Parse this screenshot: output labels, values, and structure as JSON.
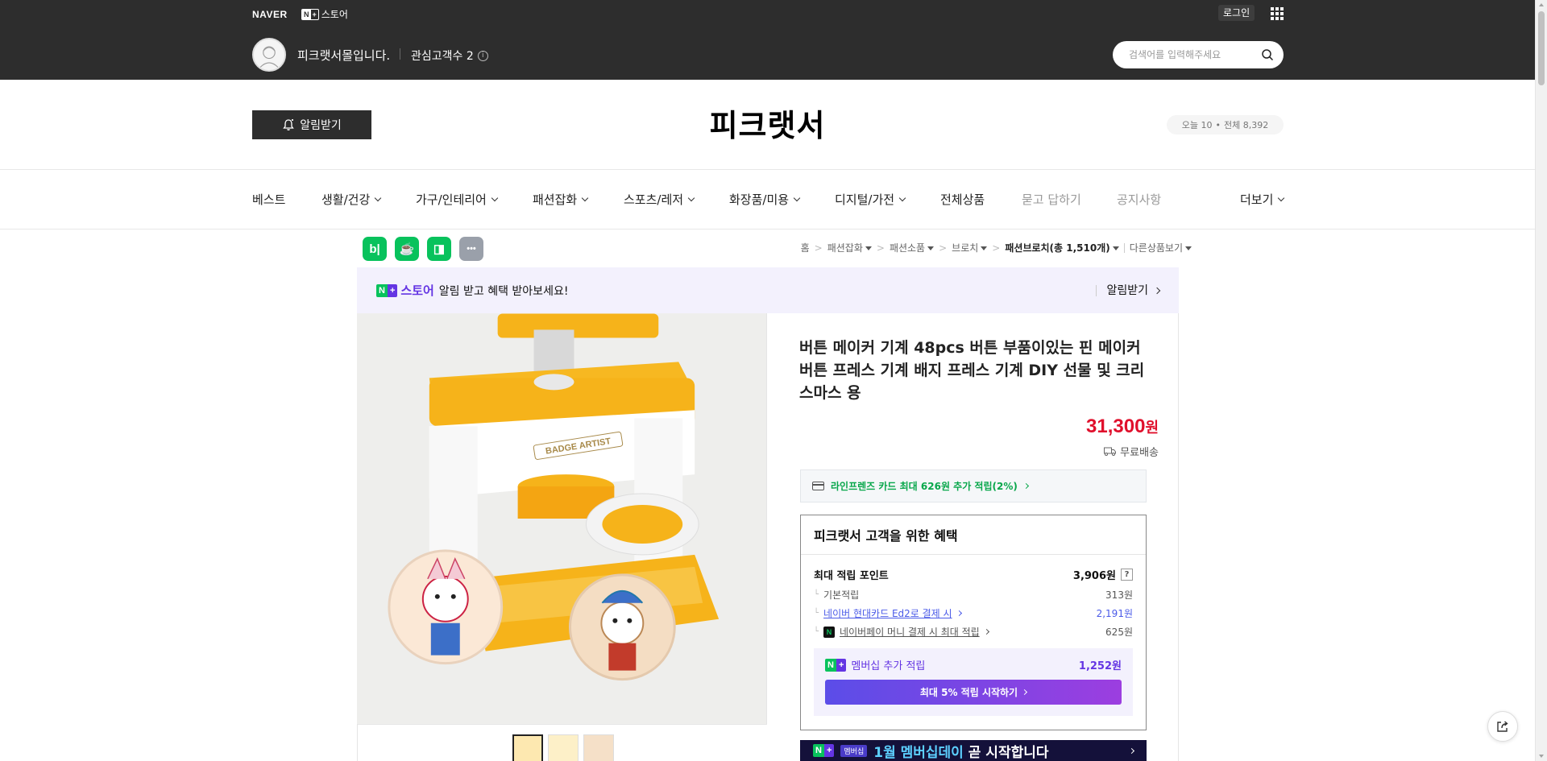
{
  "gnb": {
    "naver_logo": "NAVER",
    "nstore_n": "N",
    "nstore_plus": "+",
    "nstore_label": "스토어",
    "login": "로그인"
  },
  "store_bar": {
    "name": "피크랫서몰입니다.",
    "interest_label": "관심고객수 2",
    "search_placeholder": "검색어를 입력해주세요"
  },
  "store_header": {
    "alarm_button": "알림받기",
    "title": "피크랫서",
    "today": "오늘 10",
    "total": "전체 8,392"
  },
  "category_nav": [
    {
      "label": "베스트",
      "dropdown": false,
      "muted": false
    },
    {
      "label": "생활/건강",
      "dropdown": true,
      "muted": false
    },
    {
      "label": "가구/인테리어",
      "dropdown": true,
      "muted": false
    },
    {
      "label": "패션잡화",
      "dropdown": true,
      "muted": false
    },
    {
      "label": "스포츠/레저",
      "dropdown": true,
      "muted": false
    },
    {
      "label": "화장품/미용",
      "dropdown": true,
      "muted": false
    },
    {
      "label": "디지털/가전",
      "dropdown": true,
      "muted": false
    },
    {
      "label": "전체상품",
      "dropdown": false,
      "muted": false
    },
    {
      "label": "묻고 답하기",
      "dropdown": false,
      "muted": true
    },
    {
      "label": "공지사항",
      "dropdown": false,
      "muted": true
    },
    {
      "label": "더보기",
      "dropdown": true,
      "muted": false
    }
  ],
  "share_icons": [
    {
      "icon": "blog-share-icon",
      "glyph": "b|",
      "color": "#08c25c"
    },
    {
      "icon": "cafe-share-icon",
      "glyph": "☕",
      "color": "#08c25c"
    },
    {
      "icon": "bookmark-share-icon",
      "glyph": "◨",
      "color": "#08c25c"
    },
    {
      "icon": "more-share-icon",
      "glyph": "•••",
      "color": "#9aa0aa"
    }
  ],
  "breadcrumb": {
    "home": "홈",
    "level1": "패션잡화",
    "level2": "패션소품",
    "level3": "브로치",
    "current": "패션브로치(총 1,510개)",
    "other": "다른상품보기"
  },
  "membership_banner": {
    "logo_label": "스토어",
    "text": "알림 받고 혜택 받아보세요!",
    "action": "알림받기"
  },
  "product": {
    "title": "버튼 메이커 기계 48pcs 버튼 부품이있는 핀 메이커 버튼 프레스 기계 배지 프레스 기계 DIY 선물 및 크리스마스 용",
    "price": "31,300",
    "currency": "원",
    "shipping": "무료배송",
    "image_badge_text": "BADGE ARTIST",
    "card_benefit": "라인프렌즈 카드 최대 626원 추가 적립(2%)"
  },
  "benefits": {
    "title": "피크랫서 고객을 위한 혜택",
    "max_points_label": "최대 적립 포인트",
    "max_points_value": "3,906원",
    "help": "?",
    "rows": [
      {
        "label": "기본적립",
        "value": "313원",
        "link": false
      },
      {
        "label": "네이버 현대카드 Ed2로 결제 시",
        "value": "2,191원",
        "link": true
      },
      {
        "label": "네이버페이 머니 결제 시 최대 적립",
        "value": "625원",
        "link": true
      }
    ],
    "membership_label": "멤버십 추가 적립",
    "membership_value": "1,252원",
    "membership_button": "최대 5% 적립 시작하기"
  },
  "member_day": {
    "tag": "멤버십",
    "text_highlight": "1월 멤버십데이",
    "text_rest": " 곧 시작합니다"
  },
  "colors": {
    "accent_green": "#08c25c",
    "accent_purple": "#6435e3",
    "price_red": "#e0102c",
    "link_blue": "#4a5ae8",
    "dark_band": "#2d2d2d"
  }
}
